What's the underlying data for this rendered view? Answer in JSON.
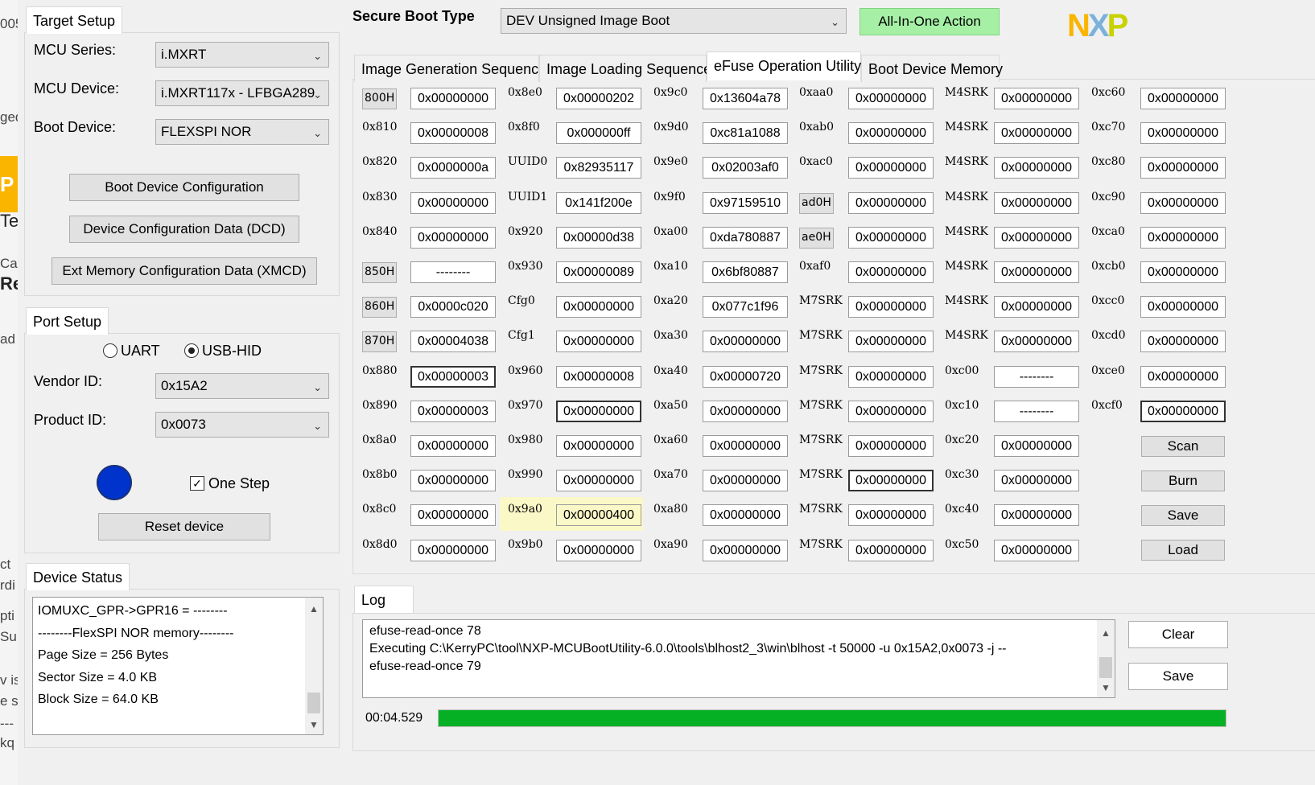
{
  "background_fragments": [
    "005",
    "ged",
    "P",
    "Te",
    "Cas",
    "Re",
    "ad",
    "ct",
    "rdi",
    "pti",
    "Su",
    "v is",
    "e s",
    "---",
    "kq"
  ],
  "target_setup": {
    "title": "Target Setup",
    "mcu_series_label": "MCU Series:",
    "mcu_series_value": "i.MXRT",
    "mcu_device_label": "MCU Device:",
    "mcu_device_value": "i.MXRT117x - LFBGA289",
    "boot_device_label": "Boot Device:",
    "boot_device_value": "FLEXSPI NOR",
    "btn_boot_device_config": "Boot Device Configuration",
    "btn_dcd": "Device Configuration Data (DCD)",
    "btn_xmcd": "Ext Memory Configuration Data (XMCD)"
  },
  "port_setup": {
    "title": "Port Setup",
    "uart_label": "UART",
    "usbhid_label": "USB-HID",
    "selected": "USB-HID",
    "vendor_id_label": "Vendor ID:",
    "vendor_id_value": "0x15A2",
    "product_id_label": "Product ID:",
    "product_id_value": "0x0073",
    "status_led_color": "#0033cc",
    "one_step_label": "One Step",
    "one_step_checked": true,
    "reset_button": "Reset device"
  },
  "device_status": {
    "title": "Device Status",
    "lines": [
      "IOMUXC_GPR->GPR16 = --------",
      "--------FlexSPI NOR memory--------",
      "Page Size   = 256 Bytes",
      "Sector Size = 4.0 KB",
      "Block Size  = 64.0 KB"
    ]
  },
  "header": {
    "secure_boot_type_label": "Secure Boot Type",
    "secure_boot_type_value": "DEV Unsigned Image Boot",
    "all_in_one_button": "All-In-One Action",
    "logo_text": "NXP",
    "accent_green": "#a6f0a6"
  },
  "tabs": [
    {
      "label": "Image Generation Sequence",
      "active": false
    },
    {
      "label": "Image Loading Sequence",
      "active": false
    },
    {
      "label": "eFuse Operation Utility",
      "active": true
    },
    {
      "label": "Boot Device Memory",
      "active": false
    }
  ],
  "efuse": {
    "columns": [
      {
        "labels": [
          "800H",
          "0x810",
          "0x820",
          "0x830",
          "0x840",
          "850H",
          "860H",
          "870H",
          "0x880",
          "0x890",
          "0x8a0",
          "0x8b0",
          "0x8c0",
          "0x8d0"
        ],
        "label_boxed": [
          true,
          false,
          false,
          false,
          false,
          true,
          true,
          true,
          false,
          false,
          false,
          false,
          false,
          false
        ],
        "values": [
          "0x00000000",
          "0x00000008",
          "0x0000000a",
          "0x00000000",
          "0x00000000",
          "--------",
          "0x0000c020",
          "0x00004038",
          "0x00000003",
          "0x00000003",
          "0x00000000",
          "0x00000000",
          "0x00000000",
          "0x00000000"
        ],
        "thick": [
          false,
          false,
          false,
          false,
          false,
          false,
          false,
          false,
          true,
          false,
          false,
          false,
          false,
          false
        ]
      },
      {
        "labels": [
          "0x8e0",
          "0x8f0",
          "UUID0",
          "UUID1",
          "0x920",
          "0x930",
          "Cfg0",
          "Cfg1",
          "0x960",
          "0x970",
          "0x980",
          "0x990",
          "0x9a0",
          "0x9b0"
        ],
        "label_boxed": [
          false,
          false,
          false,
          false,
          false,
          false,
          false,
          false,
          false,
          false,
          false,
          false,
          false,
          false
        ],
        "values": [
          "0x00000202",
          "0x000000ff",
          "0x82935117",
          "0x141f200e",
          "0x00000d38",
          "0x00000089",
          "0x00000000",
          "0x00000000",
          "0x00000008",
          "0x00000000",
          "0x00000000",
          "0x00000000",
          "0x00000400",
          "0x00000000"
        ],
        "thick": [
          false,
          false,
          false,
          false,
          false,
          false,
          false,
          false,
          false,
          true,
          false,
          false,
          false,
          false
        ],
        "highlight_row": 12
      },
      {
        "labels": [
          "0x9c0",
          "0x9d0",
          "0x9e0",
          "0x9f0",
          "0xa00",
          "0xa10",
          "0xa20",
          "0xa30",
          "0xa40",
          "0xa50",
          "0xa60",
          "0xa70",
          "0xa80",
          "0xa90"
        ],
        "label_boxed": [
          false,
          false,
          false,
          false,
          false,
          false,
          false,
          false,
          false,
          false,
          false,
          false,
          false,
          false
        ],
        "values": [
          "0x13604a78",
          "0xc81a1088",
          "0x02003af0",
          "0x97159510",
          "0xda780887",
          "0x6bf80887",
          "0x077c1f96",
          "0x00000000",
          "0x00000720",
          "0x00000000",
          "0x00000000",
          "0x00000000",
          "0x00000000",
          "0x00000000"
        ],
        "thick": [
          false,
          false,
          false,
          false,
          false,
          false,
          false,
          false,
          false,
          false,
          false,
          false,
          false,
          false
        ]
      },
      {
        "labels": [
          "0xaa0",
          "0xab0",
          "0xac0",
          "ad0H",
          "ae0H",
          "0xaf0",
          "M7SRK",
          "M7SRK",
          "M7SRK",
          "M7SRK",
          "M7SRK",
          "M7SRK",
          "M7SRK",
          "M7SRK"
        ],
        "label_boxed": [
          false,
          false,
          false,
          true,
          true,
          false,
          false,
          false,
          false,
          false,
          false,
          false,
          false,
          false
        ],
        "values": [
          "0x00000000",
          "0x00000000",
          "0x00000000",
          "0x00000000",
          "0x00000000",
          "0x00000000",
          "0x00000000",
          "0x00000000",
          "0x00000000",
          "0x00000000",
          "0x00000000",
          "0x00000000",
          "0x00000000",
          "0x00000000"
        ],
        "thick": [
          false,
          false,
          false,
          false,
          false,
          false,
          false,
          false,
          false,
          false,
          false,
          true,
          false,
          false
        ]
      },
      {
        "labels": [
          "M4SRK",
          "M4SRK",
          "M4SRK",
          "M4SRK",
          "M4SRK",
          "M4SRK",
          "M4SRK",
          "M4SRK",
          "0xc00",
          "0xc10",
          "0xc20",
          "0xc30",
          "0xc40",
          "0xc50"
        ],
        "label_boxed": [
          false,
          false,
          false,
          false,
          false,
          false,
          false,
          false,
          false,
          false,
          false,
          false,
          false,
          false
        ],
        "values": [
          "0x00000000",
          "0x00000000",
          "0x00000000",
          "0x00000000",
          "0x00000000",
          "0x00000000",
          "0x00000000",
          "0x00000000",
          "--------",
          "--------",
          "0x00000000",
          "0x00000000",
          "0x00000000",
          "0x00000000"
        ],
        "thick": [
          false,
          false,
          false,
          false,
          false,
          false,
          false,
          false,
          false,
          false,
          false,
          false,
          false,
          false
        ]
      },
      {
        "labels": [
          "0xc60",
          "0xc70",
          "0xc80",
          "0xc90",
          "0xca0",
          "0xcb0",
          "0xcc0",
          "0xcd0",
          "0xce0",
          "0xcf0"
        ],
        "label_boxed": [
          false,
          false,
          false,
          false,
          false,
          false,
          false,
          false,
          false,
          false
        ],
        "values": [
          "0x00000000",
          "0x00000000",
          "0x00000000",
          "0x00000000",
          "0x00000000",
          "0x00000000",
          "0x00000000",
          "0x00000000",
          "0x00000000",
          "0x00000000"
        ],
        "thick": [
          false,
          false,
          false,
          false,
          false,
          false,
          false,
          false,
          false,
          true
        ]
      }
    ],
    "buttons": {
      "scan": "Scan",
      "burn": "Burn",
      "save": "Save",
      "load": "Load"
    }
  },
  "log": {
    "title": "Log",
    "lines": [
      "efuse-read-once 78",
      "Executing C:\\KerryPC\\tool\\NXP-MCUBootUtility-6.0.0\\tools\\blhost2_3\\win\\blhost -t 50000 -u 0x15A2,0x0073 -j --",
      "efuse-read-once 79"
    ],
    "clear_button": "Clear",
    "save_button": "Save",
    "elapsed": "00:04.529",
    "progress_percent": 100,
    "progress_color": "#06b025"
  }
}
